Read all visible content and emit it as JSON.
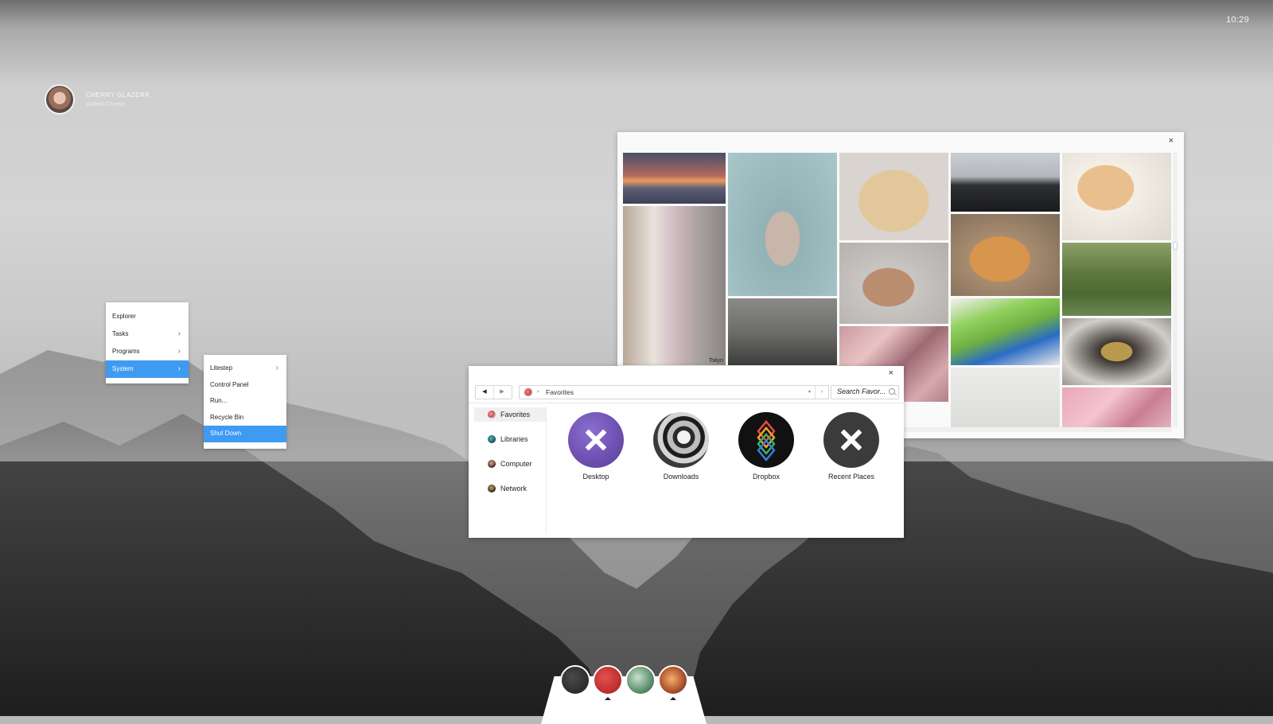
{
  "clock": {
    "time": "10:29"
  },
  "user": {
    "name": "CHERRY GLAZERR",
    "subtitle": "Grilled Cheese"
  },
  "start_menu": {
    "items": [
      {
        "label": "Explorer",
        "has_submenu": false
      },
      {
        "label": "Tasks",
        "has_submenu": true
      },
      {
        "label": "Programs",
        "has_submenu": true
      },
      {
        "label": "System",
        "has_submenu": true,
        "active": true
      }
    ]
  },
  "system_menu": {
    "items": [
      {
        "label": "Litestep",
        "has_submenu": true
      },
      {
        "label": "Control Panel"
      },
      {
        "label": "Run..."
      },
      {
        "label": "Recycle Bin"
      },
      {
        "label": "Shut Down",
        "active": true
      }
    ]
  },
  "photo_window": {
    "close_glyph": "×",
    "watermark": "Tokyo"
  },
  "explorer": {
    "close_glyph": "×",
    "back_glyph": "◀",
    "forward_glyph": "▶",
    "breadcrumb_sep": "›",
    "address": "Favorites",
    "dropdown_glyph": "▾",
    "go_glyph": "›",
    "search_placeholder": "Search Favor...",
    "sidebar": [
      {
        "label": "Favorites",
        "icon": "favorites-icon",
        "active": true
      },
      {
        "label": "Libraries",
        "icon": "libraries-icon"
      },
      {
        "label": "Computer",
        "icon": "computer-icon"
      },
      {
        "label": "Network",
        "icon": "network-icon"
      }
    ],
    "tiles": [
      {
        "label": "Desktop",
        "icon": "x-icon",
        "color": "#6d4fb0"
      },
      {
        "label": "Downloads",
        "icon": "abstract-photo-icon",
        "color": "#8a8a8a"
      },
      {
        "label": "Dropbox",
        "icon": "dropbox-icon",
        "color": "#111111"
      },
      {
        "label": "Recent Places",
        "icon": "x-icon",
        "color": "#3b3b3b"
      }
    ]
  },
  "dock": {
    "items": [
      {
        "name": "dark-app",
        "color": "#2c2c2c"
      },
      {
        "name": "red-app",
        "color": "#c62a2a"
      },
      {
        "name": "green-app",
        "color": "#7aa68a"
      },
      {
        "name": "orange-app",
        "color": "#b4572f"
      }
    ]
  },
  "colors": {
    "accent": "#3f9af2"
  }
}
